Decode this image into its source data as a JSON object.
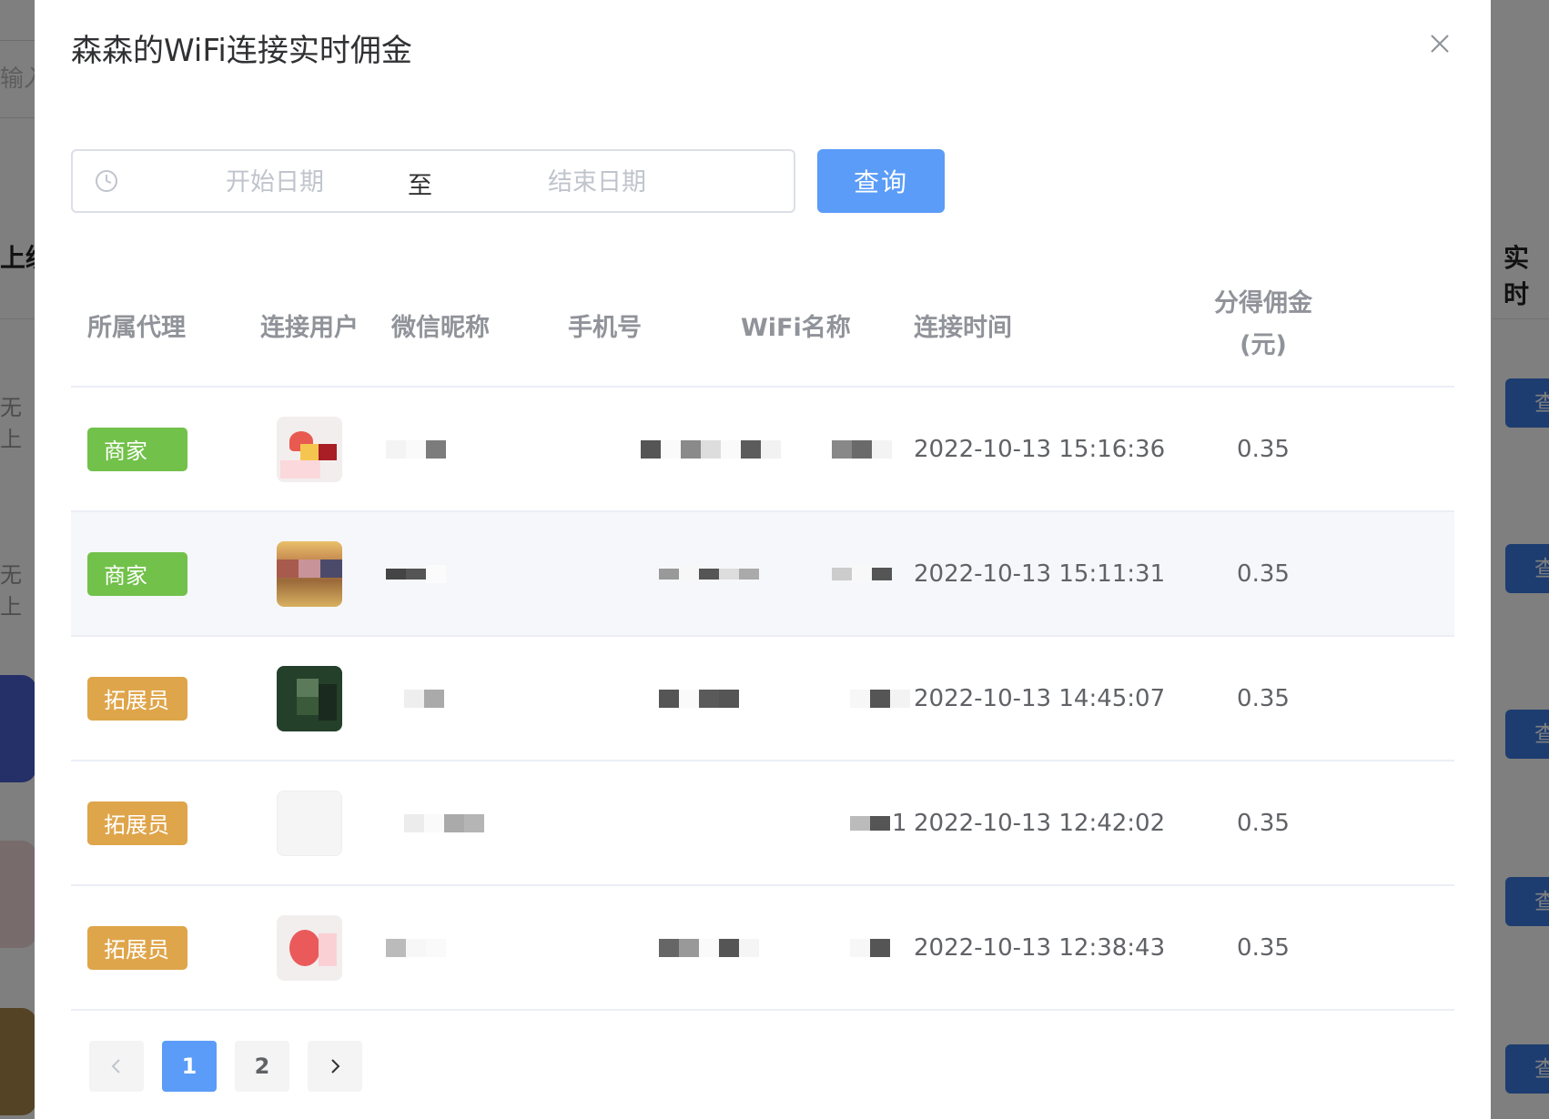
{
  "dialog": {
    "title": "森森的WiFi连接实时佣金",
    "date_start_placeholder": "开始日期",
    "date_separator": "至",
    "date_end_placeholder": "结束日期",
    "query_label": "查询"
  },
  "background": {
    "input_hint": "输入",
    "left_header": "上级",
    "right_header": "实时",
    "left_cell_text": "无上",
    "right_button_label": "查"
  },
  "table": {
    "headers": {
      "agent": "所属代理",
      "user": "连接用户",
      "nickname": "微信昵称",
      "phone": "手机号",
      "wifi": "WiFi名称",
      "time": "连接时间",
      "commission_line1": "分得佣金",
      "commission_line2": "(元)"
    },
    "rows": [
      {
        "agent": "商家",
        "agent_type": "merchant",
        "time": "2022-10-13 15:16:36",
        "amount": "0.35",
        "wifi_suffix": ""
      },
      {
        "agent": "商家",
        "agent_type": "merchant",
        "time": "2022-10-13 15:11:31",
        "amount": "0.35",
        "wifi_suffix": ""
      },
      {
        "agent": "拓展员",
        "agent_type": "expander",
        "time": "2022-10-13 14:45:07",
        "amount": "0.35",
        "wifi_suffix": ""
      },
      {
        "agent": "拓展员",
        "agent_type": "expander",
        "time": "2022-10-13 12:42:02",
        "amount": "0.35",
        "wifi_suffix": "1"
      },
      {
        "agent": "拓展员",
        "agent_type": "expander",
        "time": "2022-10-13 12:38:43",
        "amount": "0.35",
        "wifi_suffix": ""
      }
    ]
  },
  "pagination": {
    "pages": [
      "1",
      "2"
    ],
    "current": "1",
    "prev_icon": "chevron-left-icon",
    "next_icon": "chevron-right-icon"
  },
  "colors": {
    "primary": "#5a9cf8",
    "merchant_tag": "#72c14a",
    "expander_tag": "#dfa54a"
  }
}
